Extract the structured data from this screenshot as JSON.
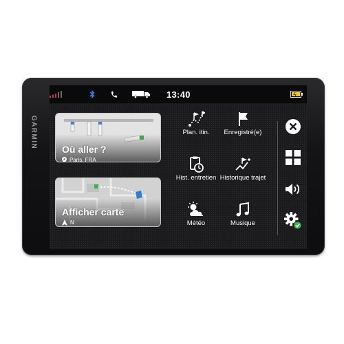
{
  "device": {
    "brand": "GARMIN"
  },
  "status_bar": {
    "time": "13:40",
    "icons": [
      "signal-icon",
      "bluetooth-icon",
      "phone-icon",
      "truck-icon",
      "battery-icon"
    ],
    "signal_color": "#cf3434",
    "battery_color": "#f3c623"
  },
  "cards": [
    {
      "title": "Où aller ?",
      "subtitle": "Paris, FRA",
      "icon": "location-pin-icon"
    },
    {
      "title": "Afficher carte",
      "subtitle": "N",
      "icon": "north-arrow-icon"
    }
  ],
  "apps": [
    {
      "label": "Plan. itin.",
      "icon": "route-planner-icon"
    },
    {
      "label": "Enregistré(e)",
      "icon": "saved-flag-icon"
    },
    {
      "label": "Hist. entretien",
      "icon": "service-history-icon"
    },
    {
      "label": "Historique trajet",
      "icon": "trip-history-icon"
    },
    {
      "label": "Météo",
      "icon": "weather-icon"
    },
    {
      "label": "Musique",
      "icon": "music-icon"
    }
  ],
  "side_buttons": [
    "close-icon",
    "apps-grid-icon",
    "volume-icon",
    "settings-icon"
  ],
  "colors": {
    "accent_green": "#3bb34a",
    "map_route": "#ffffff",
    "map_marker": "#2f7fd6"
  }
}
